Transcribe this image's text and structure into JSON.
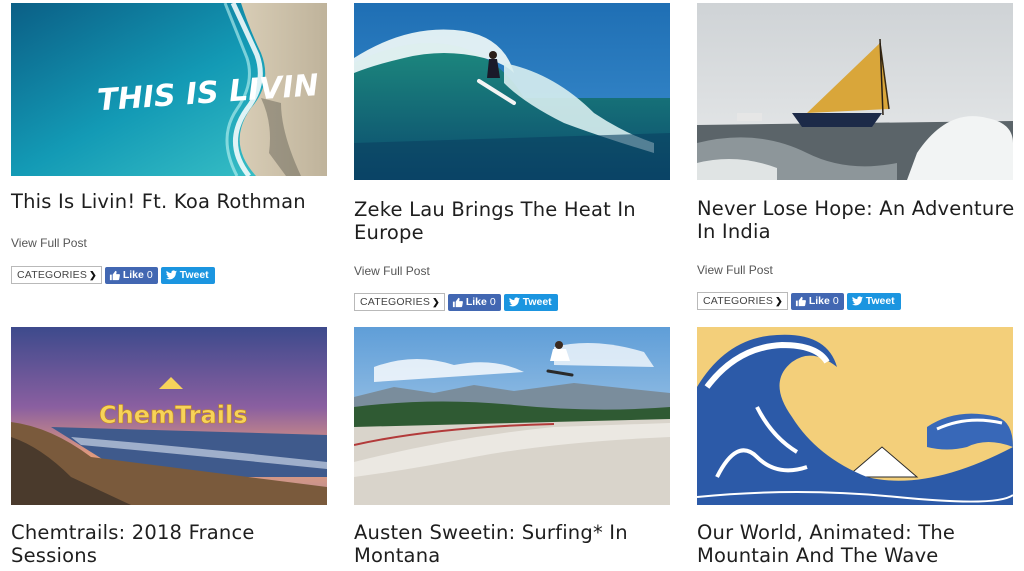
{
  "posts": [
    {
      "title": "This Is Livin! Ft. Koa Rothman",
      "view_label": "View Full Post",
      "categories_label": "CATEGORIES",
      "like_label": "Like",
      "like_count": "0",
      "tweet_label": "Tweet",
      "thumb_text": "THIS IS LIVIN",
      "thumb_icon": "aerial-beach-photo"
    },
    {
      "title": "Zeke Lau Brings The Heat In Europe",
      "view_label": "View Full Post",
      "categories_label": "CATEGORIES",
      "like_label": "Like",
      "like_count": "0",
      "tweet_label": "Tweet",
      "thumb_icon": "surfer-wave-photo"
    },
    {
      "title": "Never Lose Hope: An Adventure In India",
      "view_label": "View Full Post",
      "categories_label": "CATEGORIES",
      "like_label": "Like",
      "like_count": "0",
      "tweet_label": "Tweet",
      "thumb_icon": "sailboat-waves-photo"
    },
    {
      "title": "Chemtrails: 2018 France Sessions",
      "thumb_text": "ChemTrails",
      "thumb_icon": "sunset-beach-photo"
    },
    {
      "title": "Austen Sweetin: Surfing* In Montana",
      "thumb_icon": "skatepark-jump-photo"
    },
    {
      "title": "Our World, Animated: The Mountain And The Wave",
      "thumb_icon": "great-wave-illustration"
    }
  ],
  "colors": {
    "facebook": "#4267b2",
    "twitter": "#1b95e0",
    "title_text": "#1e1e1e",
    "link_text": "#555555"
  }
}
